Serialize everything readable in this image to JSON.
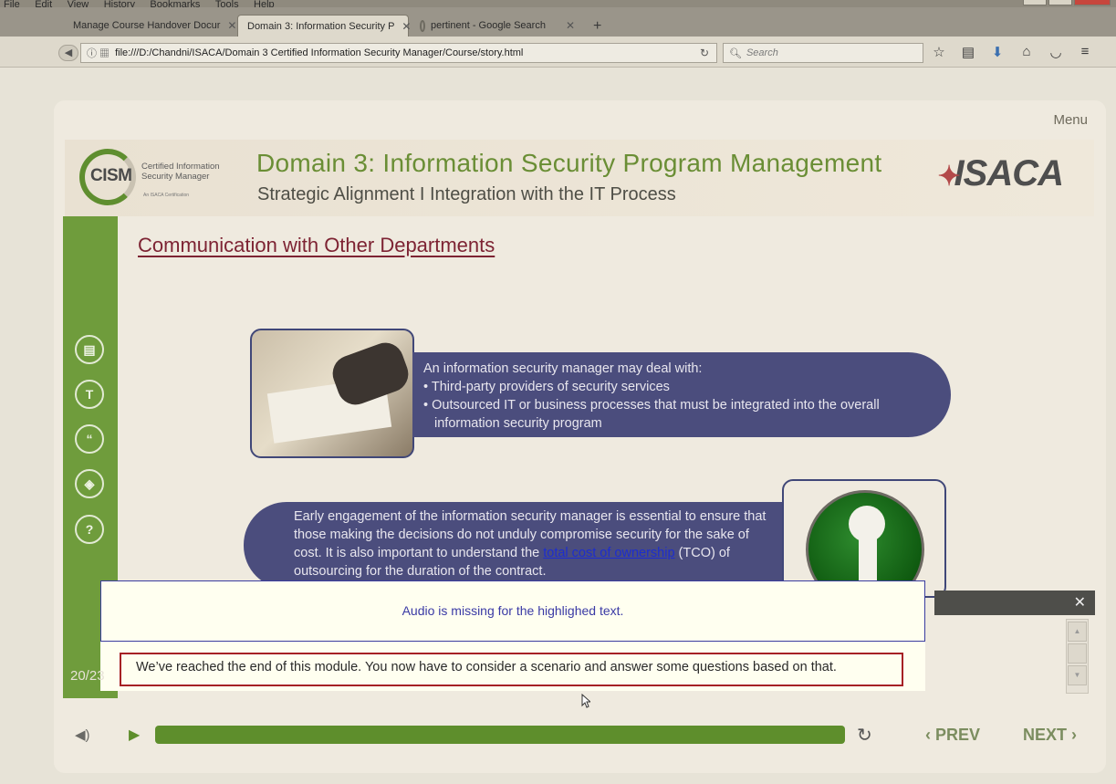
{
  "browser": {
    "menu": [
      "File",
      "Edit",
      "View",
      "History",
      "Bookmarks",
      "Tools",
      "Help"
    ],
    "tabs": [
      {
        "label": "Manage Course Handover Docur",
        "active": false
      },
      {
        "label": "Domain 3: Information Security P",
        "active": true
      },
      {
        "label": "pertinent - Google Search",
        "active": false
      }
    ],
    "new_tab": "+",
    "url": "file:///D:/Chandni/ISACA/Domain 3 Certified Information Security Manager/Course/story.html",
    "search_placeholder": "Search"
  },
  "course": {
    "menu_label": "Menu",
    "cism_logo": {
      "abbr": "CISM",
      "line1": "Certified Information",
      "line2": "Security Manager",
      "tagline": "An ISACA Certification"
    },
    "title": "Domain 3: Information Security Program Management",
    "subtitle": "Strategic Alignment I Integration with the IT Process",
    "brand": "ISACA",
    "section_heading": "Communication with Other Departments",
    "bubble1": {
      "intro": "An information security manager may deal with:",
      "items": [
        "Third-party providers of security services",
        "Outsourced IT or business processes that must be integrated into the overall information security program"
      ]
    },
    "bubble2": {
      "text_before": "Early engagement of the information security manager is essential to ensure that those making the decisions do not unduly compromise security for the sake of cost. It is also important to understand the ",
      "link": "total cost of ownership",
      "text_after": " (TCO) of outsourcing for the duration of the contract."
    },
    "modal_message": "Audio is missing for the highlighed text.",
    "end_note": "We’ve reached the end of this module. You now have to consider a scenario and answer some questions based on that.",
    "slide_counter": "20/23",
    "progress_fraction": 1.0,
    "prev_label": "PREV",
    "next_label": "NEXT"
  },
  "colors": {
    "accent_green": "#6f9c3c",
    "bubble_navy": "#4b4d7d",
    "heading_maroon": "#7d2333",
    "highlight_red": "#a62125"
  }
}
